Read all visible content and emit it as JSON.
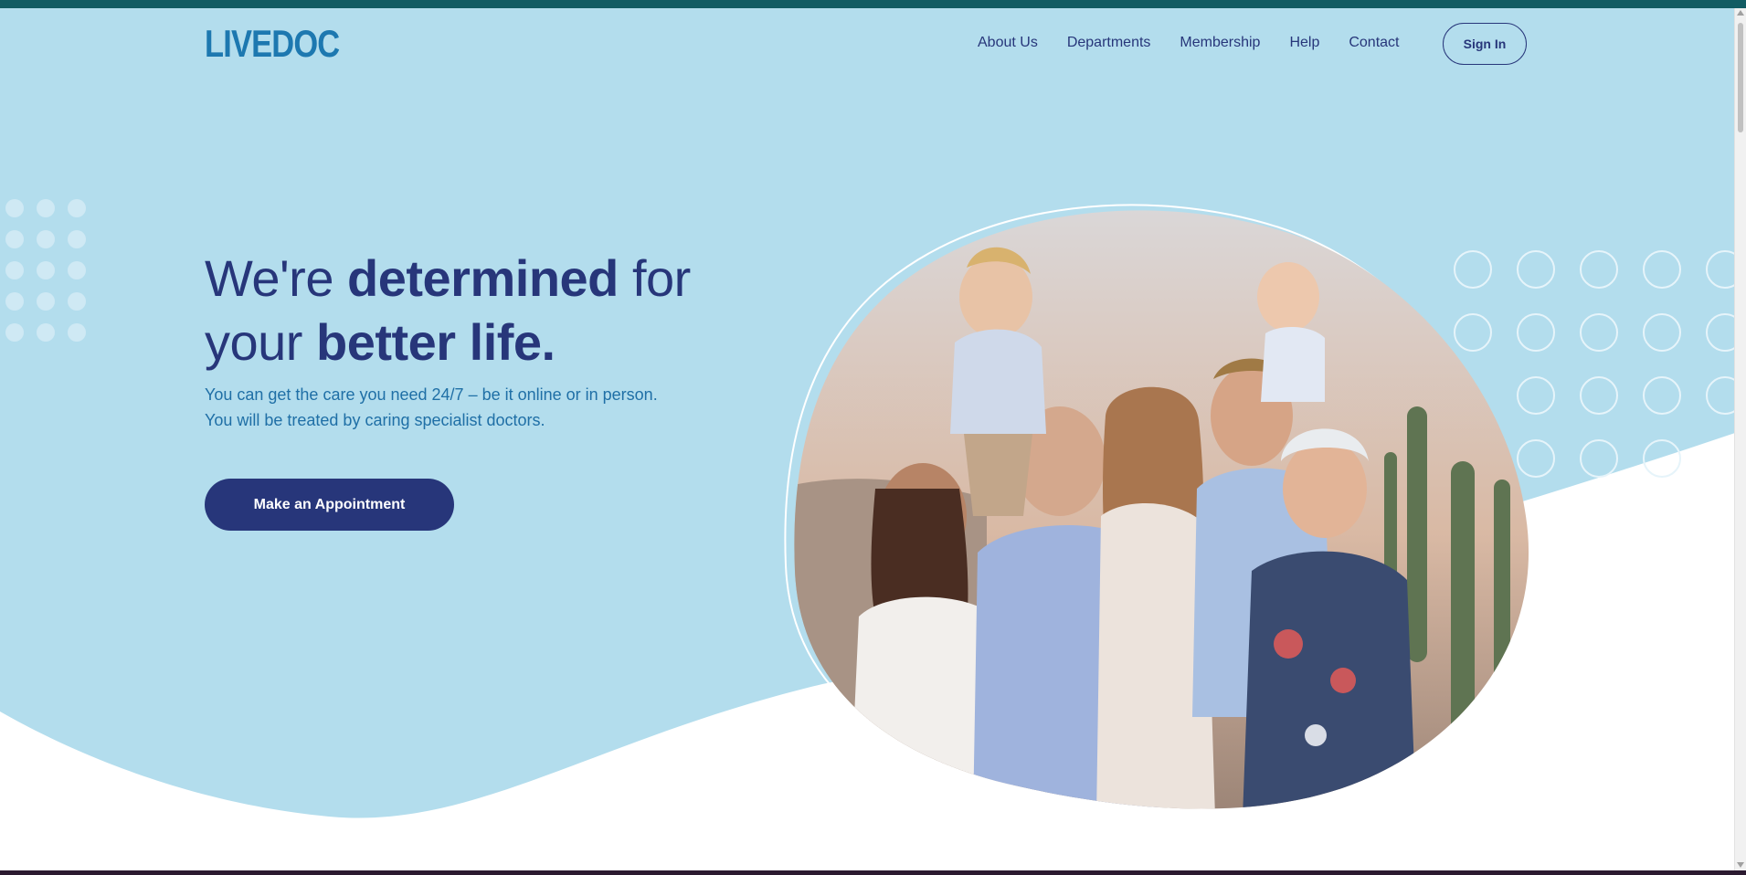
{
  "header": {
    "logo": "LIVEDOC",
    "nav": [
      "About Us",
      "Departments",
      "Membership",
      "Help",
      "Contact"
    ],
    "sign_in_label": "Sign In"
  },
  "hero": {
    "heading": {
      "line1_prefix": "We're ",
      "line1_bold": "determined",
      "line1_suffix": " for",
      "line2_prefix": "your ",
      "line2_bold": "better life."
    },
    "subtext": "You can get the care you need 24/7 – be it online or in person. You will be treated by caring specialist doctors.",
    "cta_label": "Make an Appointment"
  },
  "colors": {
    "hero_background": "#b3dded",
    "navy": "#27367a",
    "brand_blue": "#1d78b0",
    "top_strip": "#125c63"
  },
  "icons": [
    "dot-pattern-icon",
    "circle-pattern-icon",
    "family-photo"
  ]
}
